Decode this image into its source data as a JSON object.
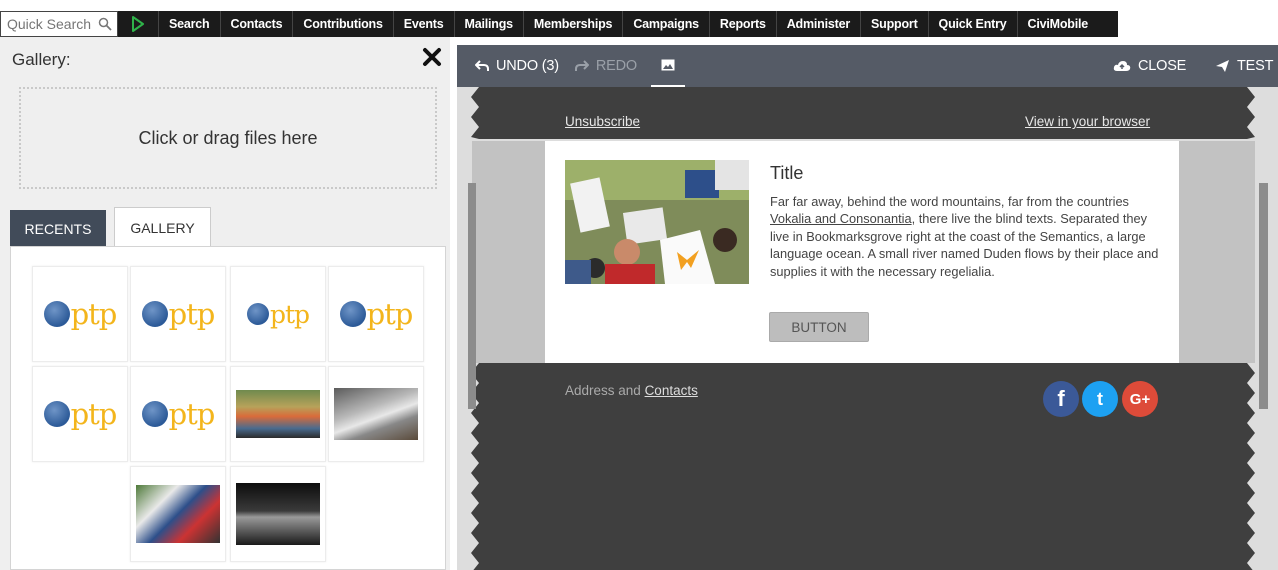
{
  "nav": {
    "quick_search_placeholder": "Quick Search",
    "items": [
      "Search",
      "Contacts",
      "Contributions",
      "Events",
      "Mailings",
      "Memberships",
      "Campaigns",
      "Reports",
      "Administer",
      "Support",
      "Quick Entry",
      "CiviMobile"
    ]
  },
  "left_panel": {
    "title": "Gallery:",
    "dropzone_text": "Click or drag files here",
    "tabs": [
      "RECENTS",
      "GALLERY"
    ],
    "active_tab": "GALLERY",
    "logo_text": "ptp"
  },
  "toolbar": {
    "undo_label": "UNDO (3)",
    "redo_label": "REDO",
    "close_label": "CLOSE",
    "test_label": "TEST"
  },
  "email": {
    "unsubscribe": "Unsubscribe",
    "view_in_browser": "View in your browser",
    "title": "Title",
    "body_before": "Far far away, behind the word mountains, far from the countries ",
    "body_link": "Vokalia and Consonantia",
    "body_after": ", there live the blind texts. Separated they live in Bookmarksgrove right at the coast of the Semantics, a large language ocean. A small river named Duden flows by their place and supplies it with the necessary regelialia.",
    "button_label": "BUTTON",
    "address_text": "Address and ",
    "contacts_link": "Contacts",
    "social": [
      {
        "name": "facebook",
        "glyph": "f",
        "color": "#3b5998"
      },
      {
        "name": "twitter",
        "glyph": "t",
        "color": "#1da1f2"
      },
      {
        "name": "google-plus",
        "glyph": "G+",
        "color": "#dd4b39"
      }
    ]
  },
  "colors": {
    "nav_bg": "#1b1b1b",
    "toolbar_bg": "#555b66",
    "tab_recents_bg": "#414b59",
    "email_frame": "#3f3f3f",
    "ptp_yellow": "#f3b51c",
    "ptp_blue": "#2c5a98"
  }
}
